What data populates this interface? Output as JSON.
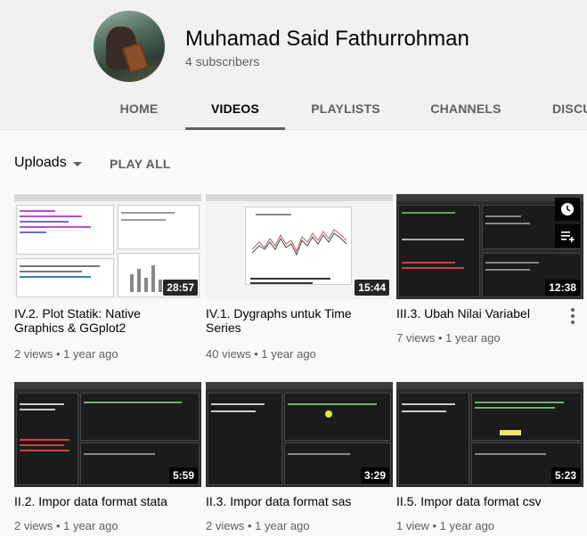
{
  "channel": {
    "name": "Muhamad Said Fathurrohman",
    "subscribers": "4 subscribers"
  },
  "tabs": [
    {
      "label": "HOME"
    },
    {
      "label": "VIDEOS"
    },
    {
      "label": "PLAYLISTS"
    },
    {
      "label": "CHANNELS"
    },
    {
      "label": "DISCU"
    }
  ],
  "toolbar": {
    "uploads_label": "Uploads",
    "play_all_label": "PLAY ALL"
  },
  "videos": [
    {
      "title": "IV.2. Plot Statik: Native Graphics & GGplot2",
      "duration": "28:57",
      "views": "2 views",
      "age": "1 year ago"
    },
    {
      "title": "IV.1. Dygraphs untuk Time Series",
      "duration": "15:44",
      "views": "40 views",
      "age": "1 year ago"
    },
    {
      "title": "III.3. Ubah Nilai Variabel",
      "duration": "12:38",
      "views": "7 views",
      "age": "1 year ago"
    },
    {
      "title": "II.2. Impor data format stata",
      "duration": "5:59",
      "views": "2 views",
      "age": "1 year ago"
    },
    {
      "title": "II.3. Impor data format sas",
      "duration": "3:29",
      "views": "2 views",
      "age": "1 year ago"
    },
    {
      "title": "II.5. Impor data format csv",
      "duration": "5:23",
      "views": "1 view",
      "age": "1 year ago"
    }
  ],
  "icons": {
    "watch_later": "clock-icon",
    "add_to_queue": "queue-icon",
    "menu": "kebab-icon",
    "dropdown": "caret-down-icon"
  }
}
